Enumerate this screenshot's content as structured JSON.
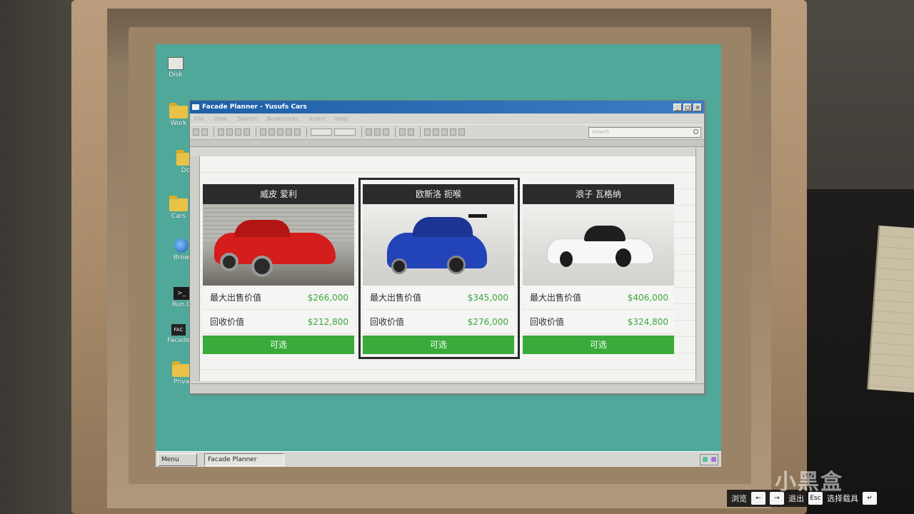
{
  "desktop": {
    "icons": [
      "Disk",
      "Work",
      "Do",
      "Cars",
      "Brow",
      "Run.C",
      "Facade",
      "Priva"
    ]
  },
  "window": {
    "title": "Facade Planner - Yusufs Cars",
    "menu": [
      "File",
      "View",
      "Search",
      "Bookmarks",
      "Insert",
      "Help"
    ],
    "search_placeholder": "Search"
  },
  "cards": [
    {
      "title": "威皮 爱利",
      "max_label": "最大出售价值",
      "max_value": "$266,000",
      "buy_label": "回收价值",
      "buy_value": "$212,800",
      "button": "可选"
    },
    {
      "title": "欧斯洛 扼喉",
      "max_label": "最大出售价值",
      "max_value": "$345,000",
      "buy_label": "回收价值",
      "buy_value": "$276,000",
      "button": "可选"
    },
    {
      "title": "浪子 瓦格纳",
      "max_label": "最大出售价值",
      "max_value": "$406,000",
      "buy_label": "回收价值",
      "buy_value": "$324,800",
      "button": "可选"
    }
  ],
  "taskbar": {
    "menu": "Menu",
    "task": "Facade Planner"
  },
  "hud": {
    "browse": "浏览",
    "exit": "退出",
    "esc": "Esc",
    "select": "选择载具"
  },
  "watermark": "小黑盒",
  "colors": {
    "desktop": "#4fa89a",
    "price": "#39a83f",
    "button": "#3aaa3a",
    "title_bar": "#1f5fa8"
  }
}
